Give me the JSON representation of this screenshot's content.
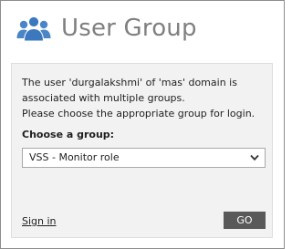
{
  "dialog": {
    "title": "User Group",
    "icon": "users-group-icon",
    "accent_color": "#4a86c5"
  },
  "message": {
    "line1": "The user 'durgalakshmi' of 'mas' domain is",
    "line2": "associated with multiple groups.",
    "line3": "Please choose the appropriate group for login."
  },
  "group_select": {
    "label": "Choose a group:",
    "selected_value": "VSS - Monitor role",
    "icon": "chevron-down-icon"
  },
  "actions": {
    "sign_in_link": "Sign in",
    "go_button": "GO"
  }
}
